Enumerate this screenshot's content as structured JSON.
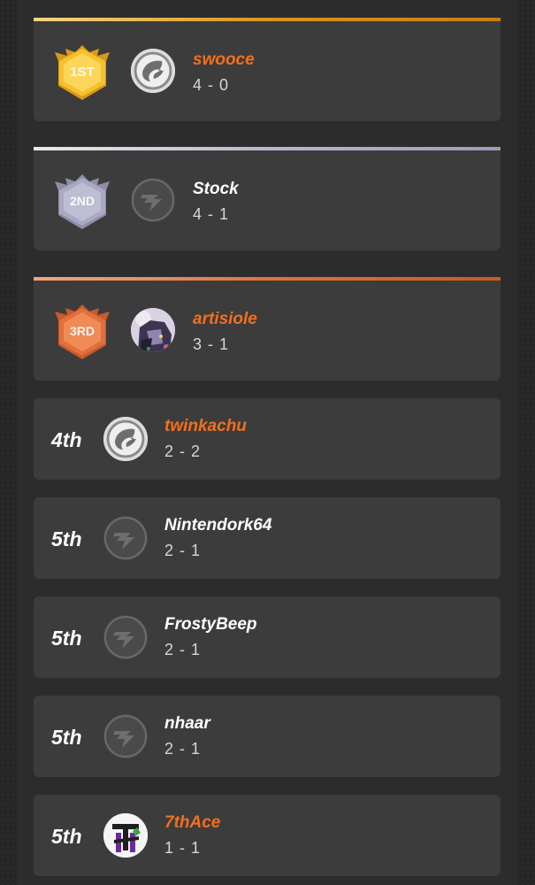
{
  "colors": {
    "accent_orange": "#f26f1f",
    "gold": "#f2b51e",
    "silver": "#a8a8c0",
    "bronze": "#e8743e",
    "card": "#3c3c3c"
  },
  "standings": [
    {
      "placement": "1ST",
      "name": "swooce",
      "record": "4 - 0",
      "highlight": true,
      "badge": "gold-wings-badge-icon",
      "avatar": "wing-logo-avatar"
    },
    {
      "placement": "2ND",
      "name": "Stock",
      "record": "4 - 1",
      "highlight": false,
      "badge": "silver-wings-badge-icon",
      "avatar": "default-avatar"
    },
    {
      "placement": "3RD",
      "name": "artisiole",
      "record": "3 - 1",
      "highlight": true,
      "badge": "bronze-wings-badge-icon",
      "avatar": "character-avatar"
    },
    {
      "placement": "4th",
      "name": "twinkachu",
      "record": "2 - 2",
      "highlight": true,
      "avatar": "wing-logo-avatar"
    },
    {
      "placement": "5th",
      "name": "Nintendork64",
      "record": "2 - 1",
      "highlight": false,
      "avatar": "default-avatar"
    },
    {
      "placement": "5th",
      "name": "FrostyBeep",
      "record": "2 - 1",
      "highlight": false,
      "avatar": "default-avatar"
    },
    {
      "placement": "5th",
      "name": "nhaar",
      "record": "2 - 1",
      "highlight": false,
      "avatar": "default-avatar"
    },
    {
      "placement": "5th",
      "name": "7thAce",
      "record": "1 - 1",
      "highlight": true,
      "avatar": "7thace-logo-avatar"
    }
  ]
}
